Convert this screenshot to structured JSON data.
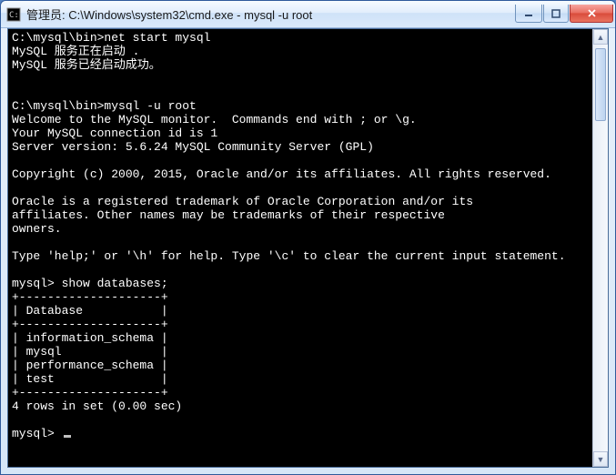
{
  "window": {
    "title": "管理员: C:\\Windows\\system32\\cmd.exe - mysql  -u root"
  },
  "terminal": {
    "prompt1": "C:\\mysql\\bin>",
    "cmd1": "net start mysql",
    "line_starting": "MySQL 服务正在启动 .",
    "line_started": "MySQL 服务已经启动成功。",
    "blank": "",
    "prompt2": "C:\\mysql\\bin>",
    "cmd2": "mysql -u root",
    "welcome": "Welcome to the MySQL monitor.  Commands end with ; or \\g.",
    "conn_id": "Your MySQL connection id is 1",
    "server_ver": "Server version: 5.6.24 MySQL Community Server (GPL)",
    "copyright": "Copyright (c) 2000, 2015, Oracle and/or its affiliates. All rights reserved.",
    "oracle1": "Oracle is a registered trademark of Oracle Corporation and/or its",
    "oracle2": "affiliates. Other names may be trademarks of their respective",
    "oracle3": "owners.",
    "help": "Type 'help;' or '\\h' for help. Type '\\c' to clear the current input statement.",
    "mysql_prompt": "mysql> ",
    "query": "show databases;",
    "tbl_hr": "+--------------------+",
    "tbl_header": "| Database           |",
    "tbl_row1": "| information_schema |",
    "tbl_row2": "| mysql              |",
    "tbl_row3": "| performance_schema |",
    "tbl_row4": "| test               |",
    "rows_msg": "4 rows in set (0.00 sec)"
  }
}
